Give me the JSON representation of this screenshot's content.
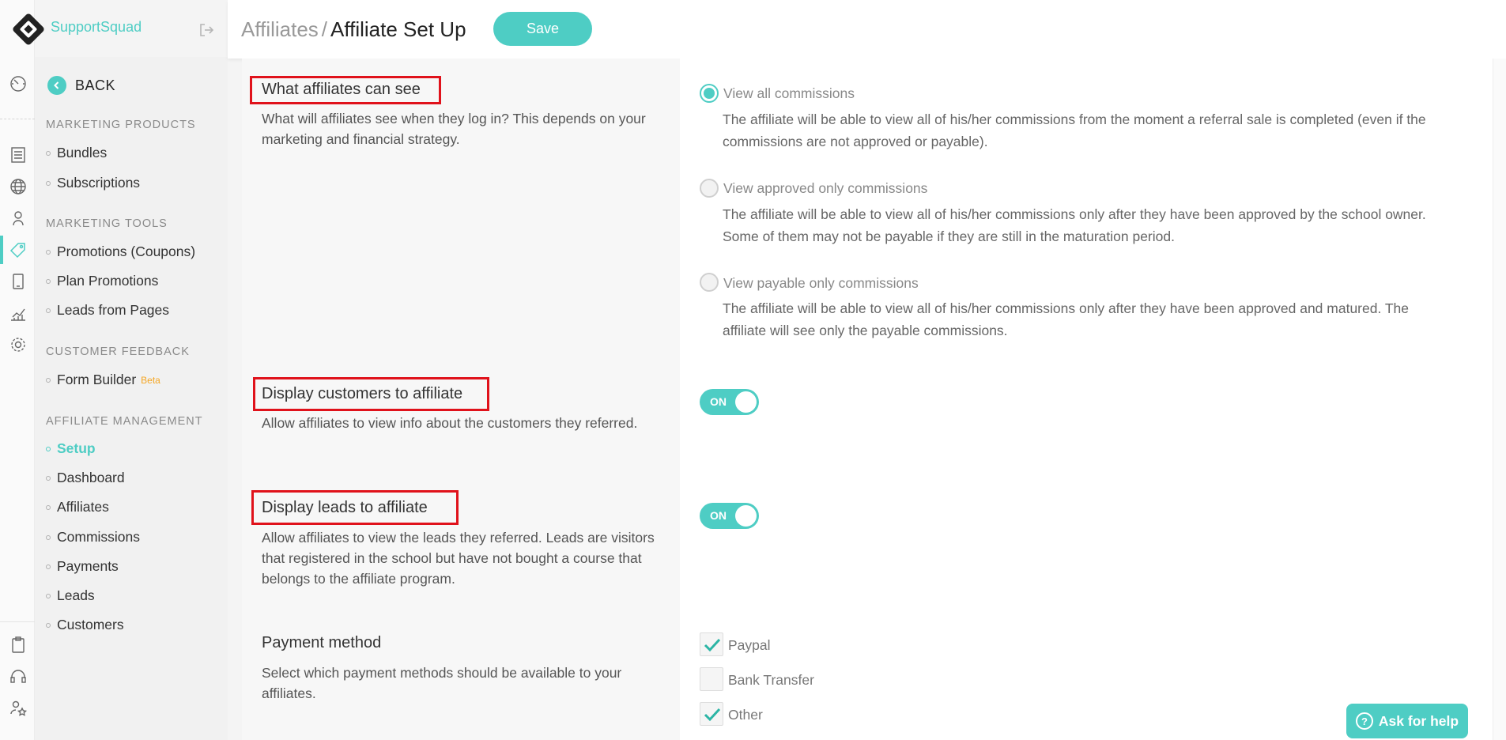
{
  "brand": {
    "name": "SupportSquad",
    "accent": "#4ecdc4"
  },
  "header": {
    "breadcrumb_parent": "Affiliates",
    "breadcrumb_separator": "/",
    "breadcrumb_current": "Affiliate Set Up",
    "save_label": "Save"
  },
  "rail_icons": [
    "dashboard-icon",
    "list-icon",
    "globe-icon",
    "user-icon",
    "tag-icon",
    "mobile-icon",
    "chart-icon",
    "gear-icon",
    "clipboard-icon",
    "headset-icon",
    "users-star-icon"
  ],
  "sidebar": {
    "back_label": "BACK",
    "sections": [
      {
        "title": "MARKETING PRODUCTS",
        "items": [
          "Bundles",
          "Subscriptions"
        ]
      },
      {
        "title": "MARKETING TOOLS",
        "items": [
          "Promotions (Coupons)",
          "Plan Promotions",
          "Leads from Pages"
        ]
      },
      {
        "title": "CUSTOMER FEEDBACK",
        "items": [
          "Form Builder"
        ],
        "badge": "Beta"
      },
      {
        "title": "AFFILIATE MANAGEMENT",
        "items": [
          "Setup",
          "Dashboard",
          "Affiliates",
          "Commissions",
          "Payments",
          "Leads",
          "Customers"
        ],
        "active": "Setup"
      }
    ]
  },
  "settings": {
    "visibility": {
      "title": "What affiliates can see",
      "description": "What will affiliates see when they log in? This depends on your marketing and financial strategy.",
      "options": [
        {
          "label": "View all commissions",
          "selected": true,
          "description": "The affiliate will be able to view all of his/her commissions from the moment a referral sale is completed (even if the commissions are not approved or payable)."
        },
        {
          "label": "View approved only commissions",
          "selected": false,
          "description": "The affiliate will be able to view all of his/her commissions only after they have been approved by the school owner. Some of them may not be payable if they are still in the maturation period."
        },
        {
          "label": "View payable only commissions",
          "selected": false,
          "description": "The affiliate will be able to view all of his/her commissions only after they have been approved and matured. The affiliate will see only the payable commissions."
        }
      ]
    },
    "display_customers": {
      "title": "Display customers to affiliate",
      "description": "Allow affiliates to view info about the customers they referred.",
      "toggle_label": "ON",
      "enabled": true
    },
    "display_leads": {
      "title": "Display leads to affiliate",
      "description": "Allow affiliates to view the leads they referred. Leads are visitors that registered in the school but have not bought a course that belongs to the affiliate program.",
      "toggle_label": "ON",
      "enabled": true
    },
    "payment_method": {
      "title": "Payment method",
      "description": "Select which payment methods should be available to your affiliates.",
      "options": [
        {
          "label": "Paypal",
          "checked": true
        },
        {
          "label": "Bank Transfer",
          "checked": false
        },
        {
          "label": "Other",
          "checked": true
        }
      ]
    }
  },
  "help": {
    "label": "Ask for help",
    "icon": "?"
  }
}
